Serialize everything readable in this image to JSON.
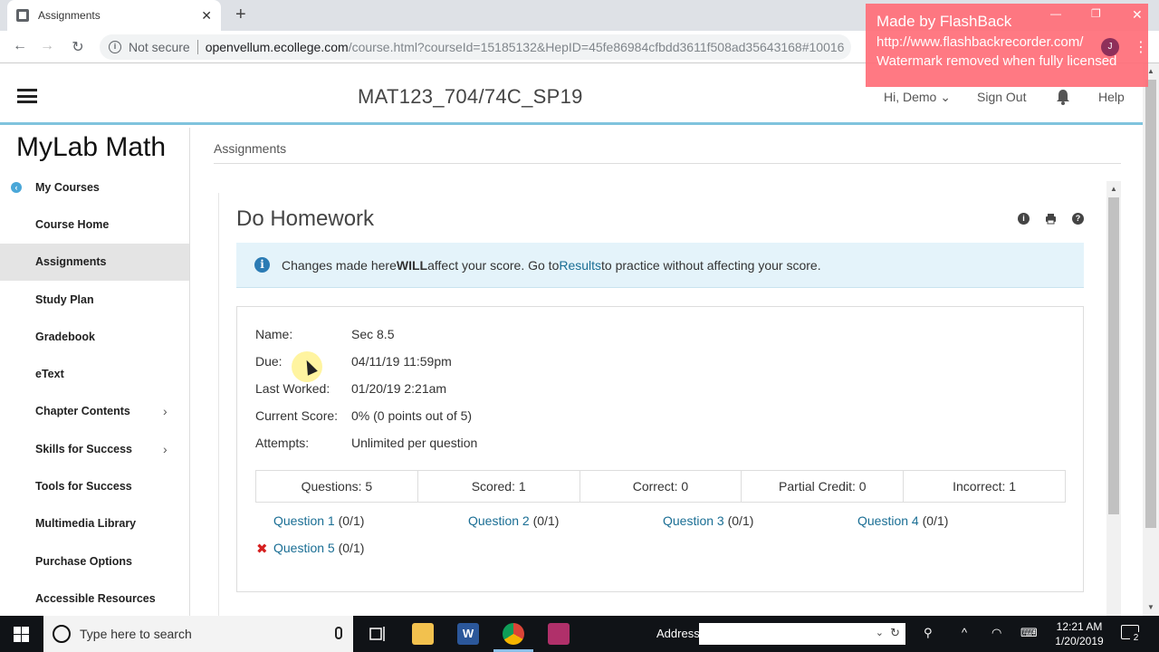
{
  "browser": {
    "tab_title": "Assignments",
    "tab_close": "✕",
    "new_tab": "+",
    "not_secure": "Not secure",
    "url_host": "openvellum.ecollege.com",
    "url_path": "/course.html?courseId=15185132&HepID=45fe86984cfbdd3611f508ad35643168#10016",
    "avatar_letter": "J"
  },
  "watermark": {
    "line1": "Made by FlashBack",
    "line2": "http://www.flashbackrecorder.com/",
    "line3": "Watermark removed when fully licensed"
  },
  "header": {
    "course_title": "MAT123_704/74C_SP19",
    "greeting": "Hi, Demo ⌄",
    "sign_out": "Sign Out",
    "help": "Help"
  },
  "sidebar": {
    "brand": "MyLab Math",
    "items": [
      {
        "label": "My Courses"
      },
      {
        "label": "Course Home"
      },
      {
        "label": "Assignments"
      },
      {
        "label": "Study Plan"
      },
      {
        "label": "Gradebook"
      },
      {
        "label": "eText"
      },
      {
        "label": "Chapter Contents"
      },
      {
        "label": "Skills for Success"
      },
      {
        "label": "Tools for Success"
      },
      {
        "label": "Multimedia Library"
      },
      {
        "label": "Purchase Options"
      },
      {
        "label": "Accessible Resources"
      }
    ]
  },
  "main": {
    "breadcrumb": "Assignments",
    "title": "Do Homework",
    "alert": {
      "pre": "Changes made here ",
      "bold": "WILL",
      "mid": " affect your score. Go to ",
      "link": "Results",
      "post": " to practice without affecting your score."
    },
    "details": [
      {
        "label": "Name:",
        "value": "Sec 8.5"
      },
      {
        "label": "Due:",
        "value": "04/11/19 11:59pm"
      },
      {
        "label": "Last Worked:",
        "value": "01/20/19 2:21am"
      },
      {
        "label": "Current Score:",
        "value": "0% (0 points out of 5)"
      },
      {
        "label": "Attempts:",
        "value": "Unlimited per question"
      }
    ],
    "stats": [
      "Questions: 5",
      "Scored: 1",
      "Correct: 0",
      "Partial Credit: 0",
      "Incorrect: 1"
    ],
    "questions": [
      {
        "label": "Question 1",
        "score": " (0/1)"
      },
      {
        "label": "Question 2",
        "score": " (0/1)"
      },
      {
        "label": "Question 3",
        "score": " (0/1)"
      },
      {
        "label": "Question 4",
        "score": " (0/1)"
      },
      {
        "label": "Question 5",
        "score": " (0/1)"
      }
    ]
  },
  "taskbar": {
    "search_placeholder": "Type here to search",
    "address_label": "Address",
    "time": "12:21 AM",
    "date": "1/20/2019",
    "notification_count": "2"
  },
  "colors": {
    "accent_link": "#1a6e94",
    "header_rule": "#7fc3dd",
    "alert_bg": "#e4f3fa",
    "incorrect_mark": "#d62020",
    "watermark_bg": "#ff6e78"
  }
}
